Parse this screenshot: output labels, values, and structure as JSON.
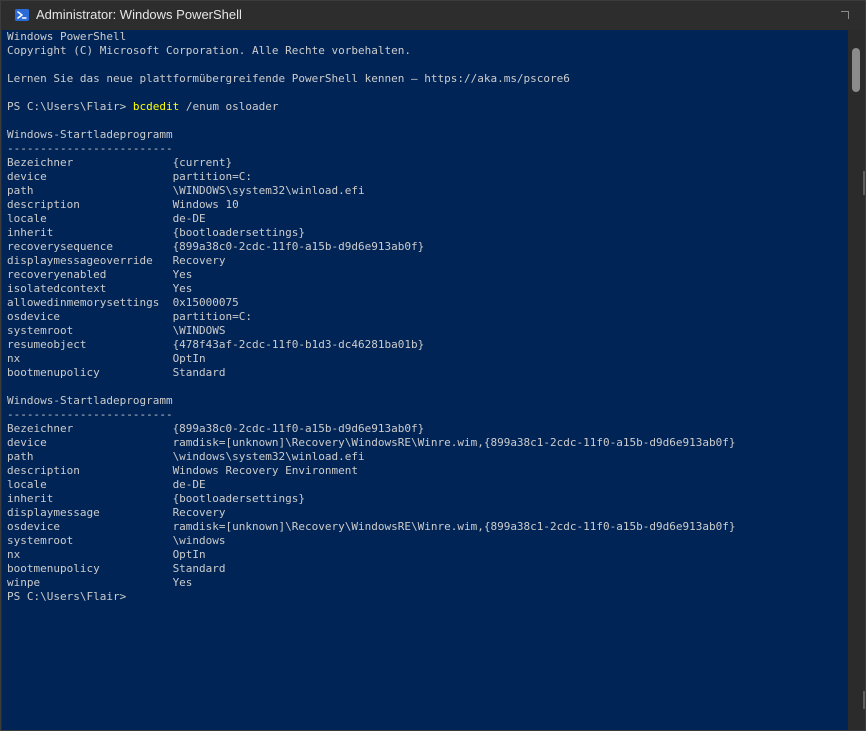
{
  "window": {
    "title": "Administrator: Windows PowerShell"
  },
  "icons": {
    "app": "powershell-icon",
    "restore": "resize-corner-icon"
  },
  "colors": {
    "console_bg": "#012456",
    "console_text": "#cccccc",
    "command_highlight": "#ffff00",
    "titlebar_bg": "#2d2d2d"
  },
  "console": {
    "lines": [
      "Windows PowerShell",
      "Copyright (C) Microsoft Corporation. Alle Rechte vorbehalten.",
      "",
      "Lernen Sie das neue plattformübergreifende PowerShell kennen – https://aka.ms/pscore6",
      "",
      "PS C:\\Users\\Flair> ",
      "",
      "Windows-Startladeprogramm",
      "-------------------------",
      "Bezeichner               {current}",
      "device                   partition=C:",
      "path                     \\WINDOWS\\system32\\winload.efi",
      "description              Windows 10",
      "locale                   de-DE",
      "inherit                  {bootloadersettings}",
      "recoverysequence         {899a38c0-2cdc-11f0-a15b-d9d6e913ab0f}",
      "displaymessageoverride   Recovery",
      "recoveryenabled          Yes",
      "isolatedcontext          Yes",
      "allowedinmemorysettings  0x15000075",
      "osdevice                 partition=C:",
      "systemroot               \\WINDOWS",
      "resumeobject             {478f43af-2cdc-11f0-b1d3-dc46281ba01b}",
      "nx                       OptIn",
      "bootmenupolicy           Standard",
      "",
      "Windows-Startladeprogramm",
      "-------------------------",
      "Bezeichner               {899a38c0-2cdc-11f0-a15b-d9d6e913ab0f}",
      "device                   ramdisk=[unknown]\\Recovery\\WindowsRE\\Winre.wim,{899a38c1-2cdc-11f0-a15b-d9d6e913ab0f}",
      "path                     \\windows\\system32\\winload.efi",
      "description              Windows Recovery Environment",
      "locale                   de-DE",
      "inherit                  {bootloadersettings}",
      "displaymessage           Recovery",
      "osdevice                 ramdisk=[unknown]\\Recovery\\WindowsRE\\Winre.wim,{899a38c1-2cdc-11f0-a15b-d9d6e913ab0f}",
      "systemroot               \\windows",
      "nx                       OptIn",
      "bootmenupolicy           Standard",
      "winpe                    Yes",
      "PS C:\\Users\\Flair>"
    ],
    "command_name": "bcdedit",
    "command_args": " /enum osloader"
  }
}
